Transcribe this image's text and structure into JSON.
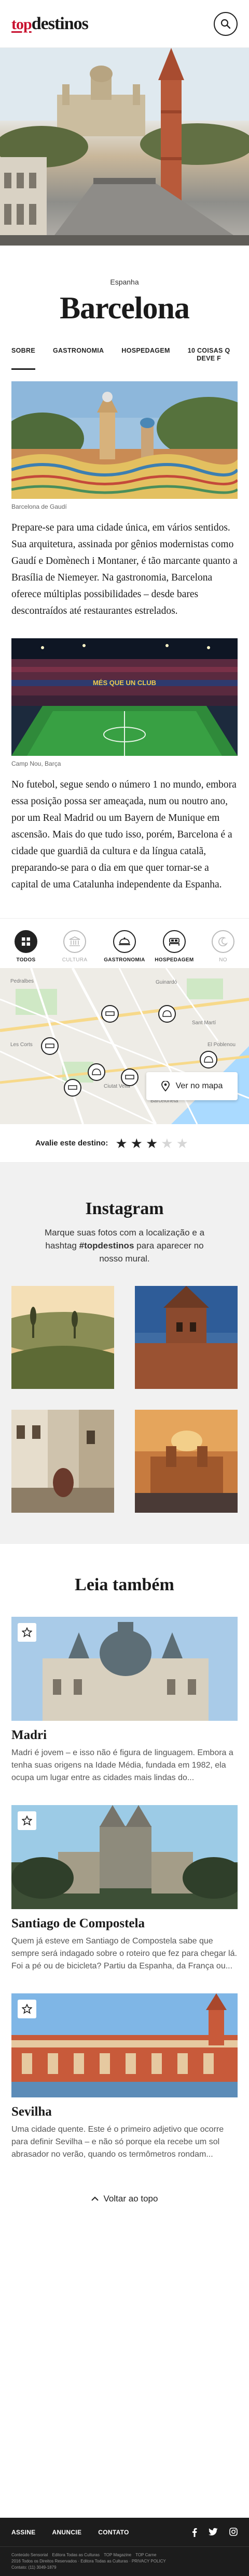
{
  "header": {
    "logo_top": "top",
    "logo_destinos": "destinos"
  },
  "hero": {
    "country": "Espanha",
    "city": "Barcelona"
  },
  "tabs": [
    "SOBRE",
    "GASTRONOMIA",
    "HOSPEDAGEM",
    "10 COISAS Q",
    "DEVE F"
  ],
  "article": {
    "photo1_caption": "Barcelona de Gaudí",
    "paragraph1": "Prepare-se para uma cidade única, em vários sentidos. Sua arquitetura, assinada por gênios modernistas como Gaudí e Domènech i Montaner, é tão marcante quanto a Brasília de Niemeyer. Na gastronomia, Barcelona oferece múltiplas possibilidades – desde bares descontraídos até restaurantes estrelados.",
    "photo2_caption": "Camp Nou, Barça",
    "stadium_banner": "MÉS QUE UN CLUB",
    "paragraph2": "No futebol, segue sendo o número 1 no mundo, embora essa posição possa ser ameaçada, num ou noutro ano, por um Real Madrid ou um Bayern de Munique em ascensão. Mais do que tudo isso, porém, Barcelona é a cidade que guardiã da cultura e da língua catalã, preparando-se para o dia em que quer tornar-se a capital de uma Catalunha independente da Espanha."
  },
  "categories": [
    {
      "label": "TODOS",
      "icon": "grid-icon",
      "state": "active"
    },
    {
      "label": "CULTURA",
      "icon": "museum-icon",
      "state": "muted"
    },
    {
      "label": "GASTRONOMIA",
      "icon": "dish-icon",
      "state": "normal"
    },
    {
      "label": "HOSPEDAGEM",
      "icon": "bed-icon",
      "state": "normal"
    },
    {
      "label": "NO",
      "icon": "moon-icon",
      "state": "muted"
    }
  ],
  "map": {
    "button_label": "Ver no mapa",
    "labels": [
      "Sant Martí",
      "Guinardó",
      "Les Corts",
      "Pedralbes",
      "El Poblenou",
      "Ciutat Vella",
      "Barceloneta"
    ]
  },
  "rating": {
    "label": "Avalie este destino:",
    "value": 3,
    "max": 5
  },
  "instagram": {
    "title": "Instagram",
    "text_before": "Marque suas fotos com a localização e a hashtag ",
    "hashtag": "#topdestinos",
    "text_after": " para aparecer no nosso mural."
  },
  "read_more": {
    "title": "Leia também",
    "cards": [
      {
        "title": "Madri",
        "text": "Madri é jovem – e isso não é figura de linguagem. Embora a tenha suas origens na Idade Média, fundada em 1982, ela ocupa um lugar entre as cidades mais lindas do..."
      },
      {
        "title": "Santiago de Compostela",
        "text": "Quem já esteve em Santiago de Compostela sabe que sempre será indagado sobre o roteiro que fez para chegar lá. Foi a pé ou de bicicleta? Partiu da Espanha, da França ou..."
      },
      {
        "title": "Sevilha",
        "text": "Uma cidade quente. Este é o primeiro adjetivo que ocorre para definir Sevilha – e não só porque ela recebe um sol abrasador no verão, quando os termômetros rondam..."
      }
    ]
  },
  "back_to_top": "Voltar ao topo",
  "footer": {
    "links": [
      "ASSINE",
      "ANUNCIE",
      "CONTATO"
    ],
    "legal": [
      "Conteúdo Sensorial",
      "Editora Todas as Culturas",
      "TOP Magazine",
      "TOP Carne"
    ],
    "legal_line2": "2016 Todos os Direitos Reservados · Editora Todas as Culturas · PRIVACY POLICY",
    "legal_line3": "Contato: (11) 3049-1879"
  }
}
